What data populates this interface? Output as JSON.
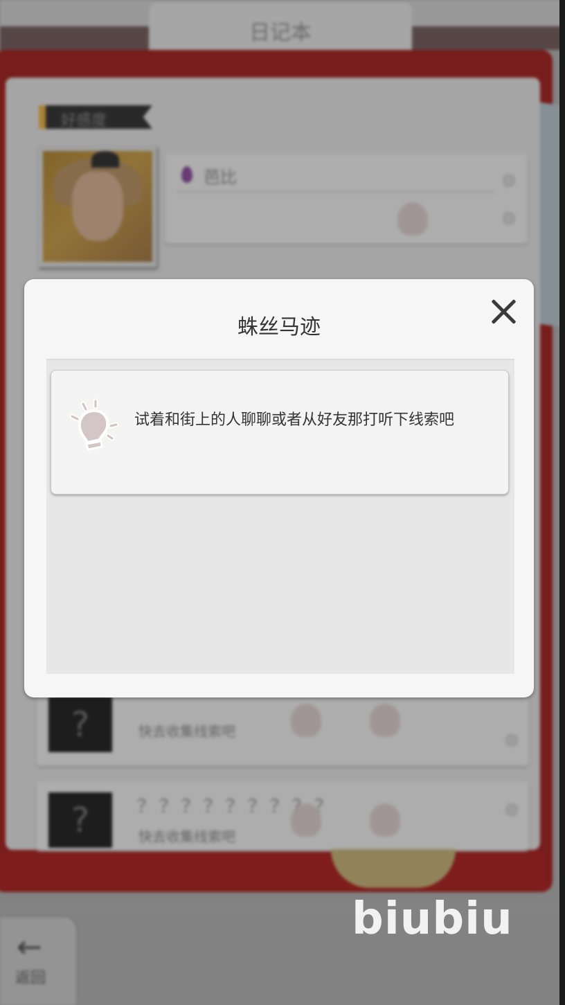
{
  "background": {
    "notebook_title": "日记本",
    "affinity_tab": "好感度",
    "character_name": "芭比",
    "hearts": [
      "♡",
      "♡",
      "♡",
      "♡",
      "♡",
      "♡"
    ],
    "unknown_rows": [
      {
        "name": "？？？？？？？？？",
        "hint": "快去收集线索吧"
      },
      {
        "name": "？？？？？？？？？",
        "hint": "快去收集线索吧"
      }
    ],
    "unknown_portrait_mark": "?",
    "back_label": "返回",
    "back_icon": "←"
  },
  "modal": {
    "title": "蛛丝马迹",
    "hint_text": "试着和街上的人聊聊或者从好友那打听下线索吧",
    "close_icon": "close-icon",
    "bulb_icon": "lightbulb-icon"
  },
  "watermark": "biubiu",
  "colors": {
    "modal_bg": "#f6f6f6",
    "modal_body_bg": "#e7e7e7",
    "frame_red": "#7f1f1d",
    "bulb": "#d4c6c6"
  }
}
